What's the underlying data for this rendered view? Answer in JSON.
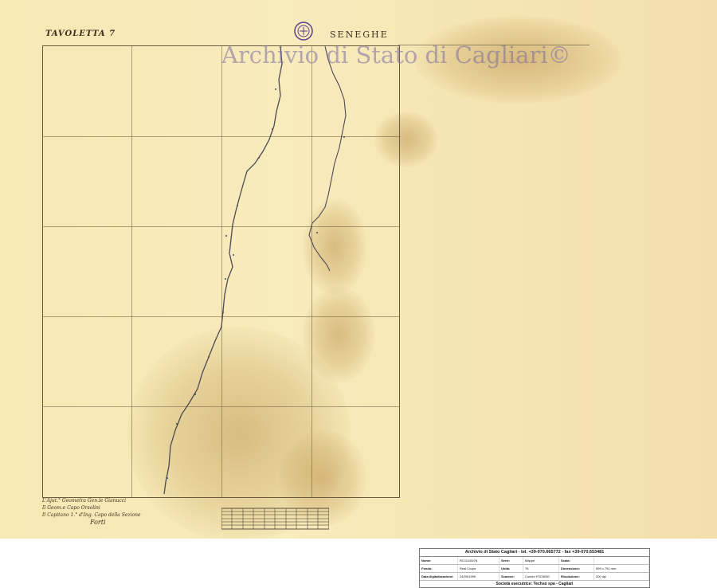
{
  "header": {
    "tavoletta": "TAVOLETTA 7",
    "sheet_name": "SENEGHE"
  },
  "watermark": "Archivio di Stato di Cagliari©",
  "signatures": [
    "L'Ajut.° Geometra Gen.le Gianucci",
    "Il Geom.e Capo Orsolini",
    "Il Capitano 1.° d'Ing. Capo della Sezione",
    "Forti"
  ],
  "colors": {
    "paper": "#f7e8b4",
    "ink": "#3a2e1e",
    "watermark": "#7a6ea0"
  },
  "info_panel": {
    "title": "Archivio di Stato Cagliari - tel. +39-070.665772 - fax +39-070.653481",
    "rows": [
      [
        {
          "label": "Nome:",
          "value": "RC/11/45/76"
        },
        {
          "label": "Serie:",
          "value": "Mappe"
        },
        {
          "label": "Scala:",
          "value": ""
        }
      ],
      [
        {
          "label": "Fondo:",
          "value": "Real Corpo"
        },
        {
          "label": "Unità:",
          "value": "76"
        },
        {
          "label": "Dimensione:",
          "value": "599 x 791 mm."
        }
      ],
      [
        {
          "label": "Data digitalizzazione:",
          "value": "24/09/1999"
        },
        {
          "label": "Scanner:",
          "value": "Contex FSC5050"
        },
        {
          "label": "Risoluzione:",
          "value": "200 dpi"
        }
      ]
    ],
    "footer": "Società esecutrice: Techso spa - Cagliari"
  }
}
